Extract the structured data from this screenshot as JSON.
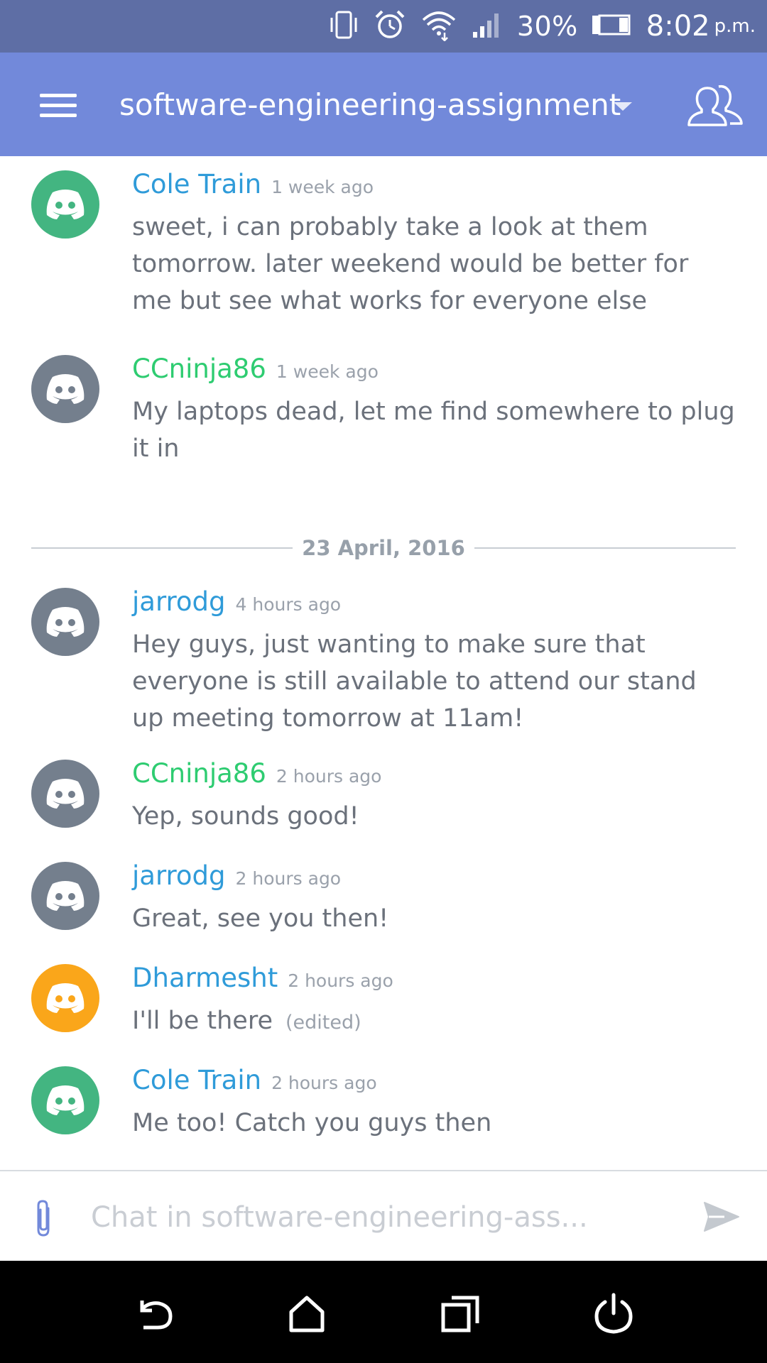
{
  "status_bar": {
    "battery": "30%",
    "time": "8:02",
    "ampm": "p.m.",
    "icons": [
      "vibrate-icon",
      "alarm-icon",
      "wifi-icon",
      "signal-icon",
      "battery-icon"
    ]
  },
  "header": {
    "channel": "software-engineering-assignment",
    "icons": [
      "menu-icon",
      "chevron-down-icon",
      "members-icon"
    ],
    "background": "#7289da"
  },
  "date_divider": "23 April, 2016",
  "messages": [
    {
      "author": "Cole Train",
      "author_color": "#2f9bd9",
      "avatar_color": "#43b581",
      "time": "1 week ago",
      "text": "sweet, i can probably take a look at them tomorrow. later weekend would be better for me but see what works for everyone else"
    },
    {
      "author": "CCninja86",
      "author_color": "#2ecc71",
      "avatar_color": "#747f8d",
      "time": "1 week ago",
      "text": "My laptops dead, let me find somewhere to plug it in"
    },
    {
      "author": "jarrodg",
      "author_color": "#2f9bd9",
      "avatar_color": "#747f8d",
      "time": "4 hours ago",
      "text": "Hey guys, just wanting to make sure that everyone is still available to attend our stand up meeting tomorrow at 11am!"
    },
    {
      "author": "CCninja86",
      "author_color": "#2ecc71",
      "avatar_color": "#747f8d",
      "time": "2 hours ago",
      "text": "Yep, sounds good!"
    },
    {
      "author": "jarrodg",
      "author_color": "#2f9bd9",
      "avatar_color": "#747f8d",
      "time": "2 hours ago",
      "text": "Great, see you then!"
    },
    {
      "author": "Dharmesht",
      "author_color": "#2f9bd9",
      "avatar_color": "#faa61a",
      "time": "2 hours ago",
      "text": "I'll be there",
      "edited": "(edited)"
    },
    {
      "author": "Cole Train",
      "author_color": "#2f9bd9",
      "avatar_color": "#43b581",
      "time": "2 hours ago",
      "text": "Me too! Catch you guys then"
    }
  ],
  "composer": {
    "placeholder": "Chat in software-engineering-ass...",
    "icons": [
      "paperclip-icon",
      "send-icon"
    ]
  },
  "nav_bar": {
    "icons": [
      "back-icon",
      "home-icon",
      "recents-icon",
      "power-icon"
    ]
  }
}
